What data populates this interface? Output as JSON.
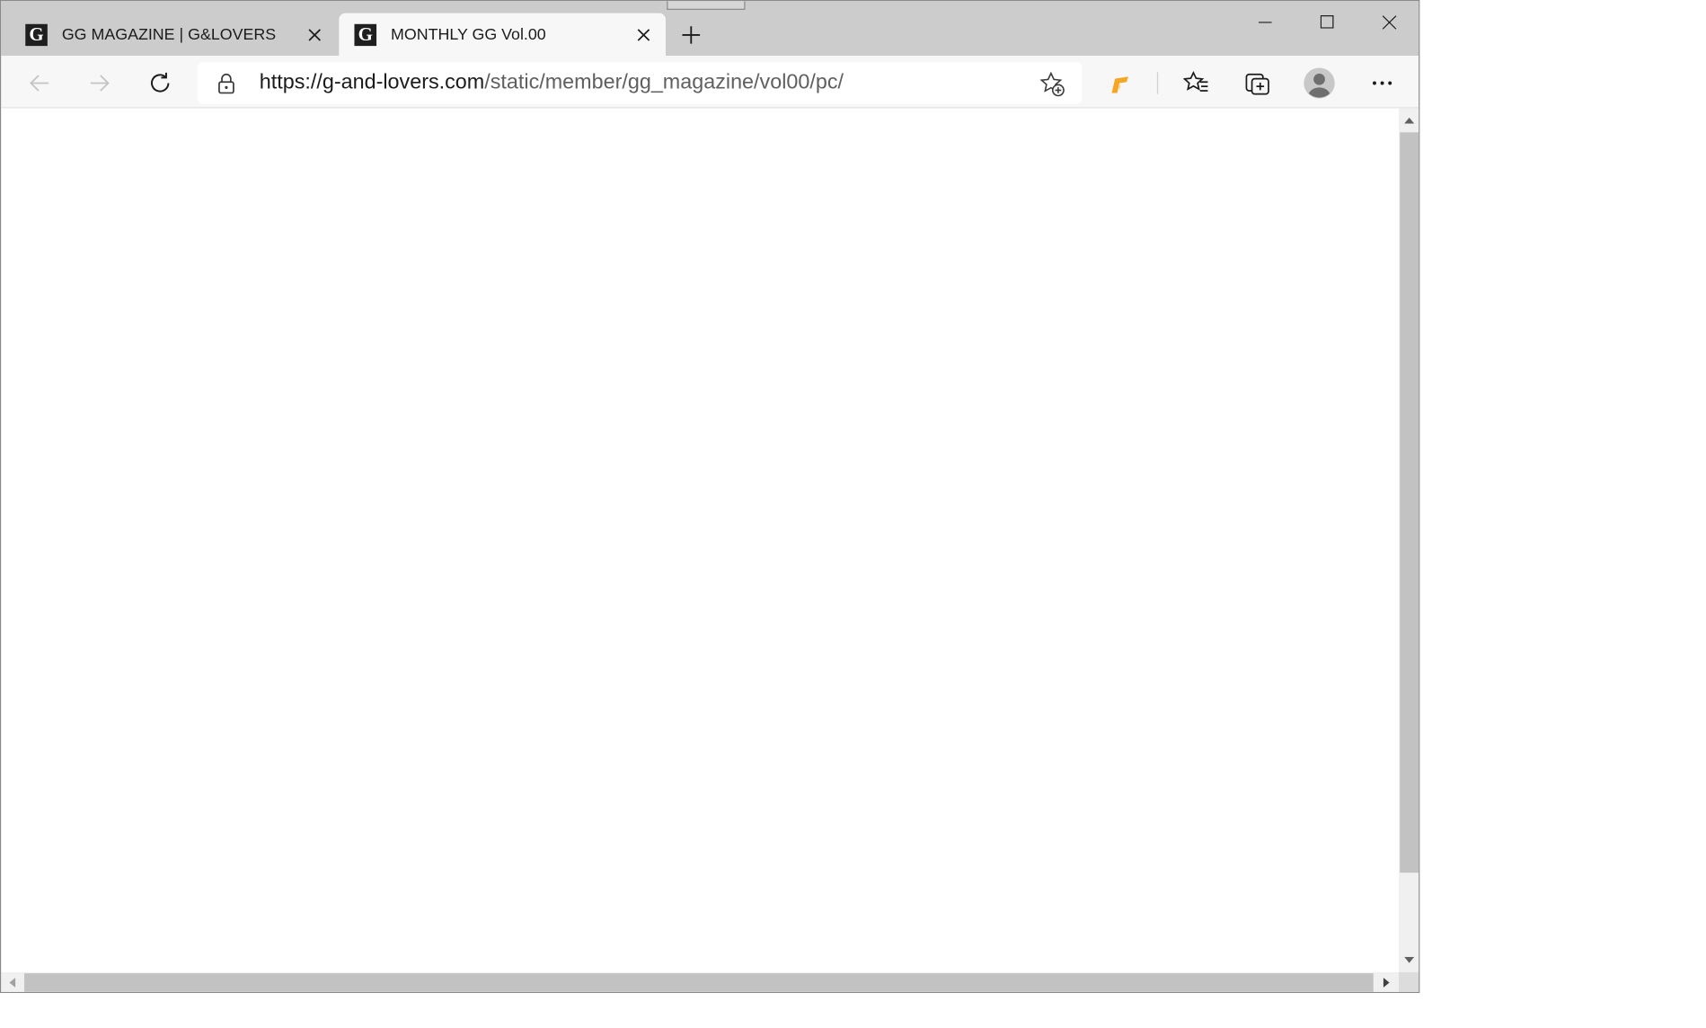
{
  "browser": {
    "tabs": [
      {
        "title": "GG MAGAZINE | G&LOVERS",
        "favicon": "G",
        "active": false
      },
      {
        "title": "MONTHLY GG Vol.00",
        "favicon": "G",
        "active": true
      }
    ],
    "address_bar": {
      "url_host": "https://g-and-lovers.com",
      "url_path": "/static/member/gg_magazine/vol00/pc/"
    },
    "icons": {
      "back": "arrow-left-icon",
      "forward": "arrow-right-icon",
      "reload": "reload-icon",
      "lock": "lock-icon",
      "add_favorite": "star-plus-icon",
      "extension": "extension-icon",
      "favorites": "favorites-icon",
      "collections": "collections-icon",
      "profile": "profile-icon",
      "more": "more-icon",
      "new_tab": "plus-icon",
      "close": "close-icon"
    },
    "colors": {
      "tabstrip": "#cccccc",
      "toolbar": "#f7f7f7",
      "extension_accent": "#f5a623",
      "scroll_thumb": "#c2c2c2"
    }
  }
}
